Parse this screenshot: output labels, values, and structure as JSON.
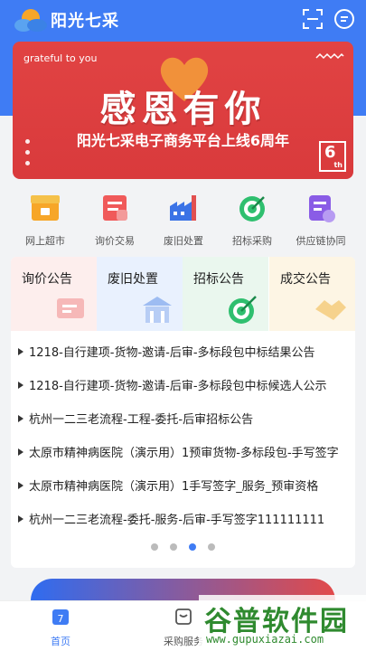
{
  "header": {
    "title": "阳光七采"
  },
  "banner": {
    "tagline": "grateful to you",
    "title": "感恩有你",
    "subtitle": "阳光七采电子商务平台上线6周年",
    "badge_number": "6",
    "badge_suffix": "th"
  },
  "nav": [
    {
      "label": "网上超市",
      "icon": "shop-icon"
    },
    {
      "label": "询价交易",
      "icon": "inquiry-icon"
    },
    {
      "label": "废旧处置",
      "icon": "factory-icon"
    },
    {
      "label": "招标采购",
      "icon": "target-icon"
    },
    {
      "label": "供应链协同",
      "icon": "supply-chain-icon"
    }
  ],
  "notice_tabs": [
    {
      "label": "询价公告",
      "bg": "#fdeeed"
    },
    {
      "label": "废旧处置",
      "bg": "#e9f1fe"
    },
    {
      "label": "招标公告",
      "bg": "#eaf7ee"
    },
    {
      "label": "成交公告",
      "bg": "#fdf5e4"
    }
  ],
  "notices": [
    "1218-自行建项-货物-邀请-后审-多标段包中标结果公告",
    "1218-自行建项-货物-邀请-后审-多标段包中标候选人公示",
    "杭州一二三老流程-工程-委托-后审招标公告",
    "太原市精神病医院（演示用）1预审货物-多标段包-手写签字",
    "太原市精神病医院（演示用）1手写签字_服务_预审资格",
    "杭州一二三老流程-委托-服务-后审-手写签字111111111"
  ],
  "pager": {
    "total": 4,
    "active": 2
  },
  "bottom_nav": [
    {
      "label": "首页",
      "active": true,
      "badge": "7"
    },
    {
      "label": "采购服务",
      "active": false
    }
  ],
  "watermark": {
    "text": "谷普软件园",
    "url": "www.gupuxiazai.com"
  },
  "colors": {
    "primary": "#3f7cf4",
    "banner_red": "#e14343"
  }
}
